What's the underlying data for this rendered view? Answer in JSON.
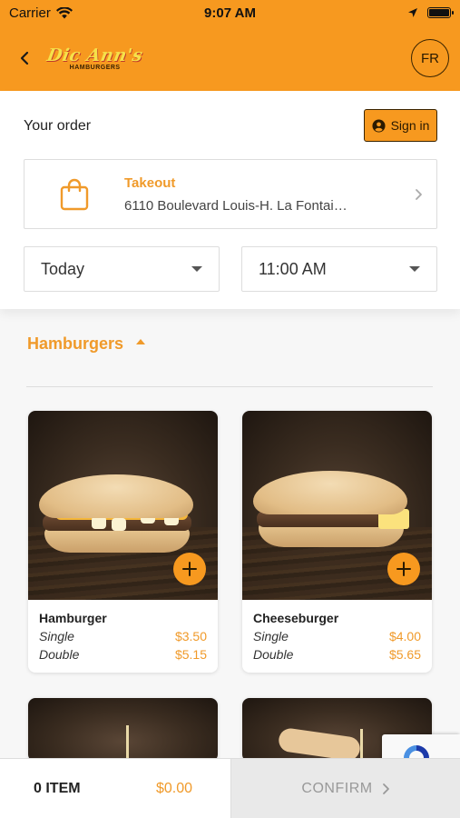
{
  "status_bar": {
    "carrier": "Carrier",
    "time": "9:07 AM"
  },
  "header": {
    "logo_text": "Dic Ann's",
    "logo_subtext": "HAMBURGERS",
    "language_button": "FR",
    "brand_color": "#f7991f"
  },
  "order": {
    "title": "Your order",
    "sign_in_label": "Sign in",
    "mode_label": "Takeout",
    "address": "6110 Boulevard Louis-H. La Fontai…",
    "date_value": "Today",
    "time_value": "11:00 AM"
  },
  "menu": {
    "section_title": "Hamburgers",
    "items": [
      {
        "name": "Hamburger",
        "options": [
          {
            "label": "Single",
            "price": "$3.50"
          },
          {
            "label": "Double",
            "price": "$5.15"
          }
        ]
      },
      {
        "name": "Cheeseburger",
        "options": [
          {
            "label": "Single",
            "price": "$4.00"
          },
          {
            "label": "Double",
            "price": "$5.65"
          }
        ]
      }
    ]
  },
  "cart": {
    "item_count_label": "0 ITEM",
    "total": "$0.00",
    "confirm_label": "CONFIRM"
  },
  "icons": {
    "back": "chevron-left-icon",
    "bag": "shopping-bag-icon",
    "user": "user-circle-icon",
    "add": "plus-icon"
  }
}
